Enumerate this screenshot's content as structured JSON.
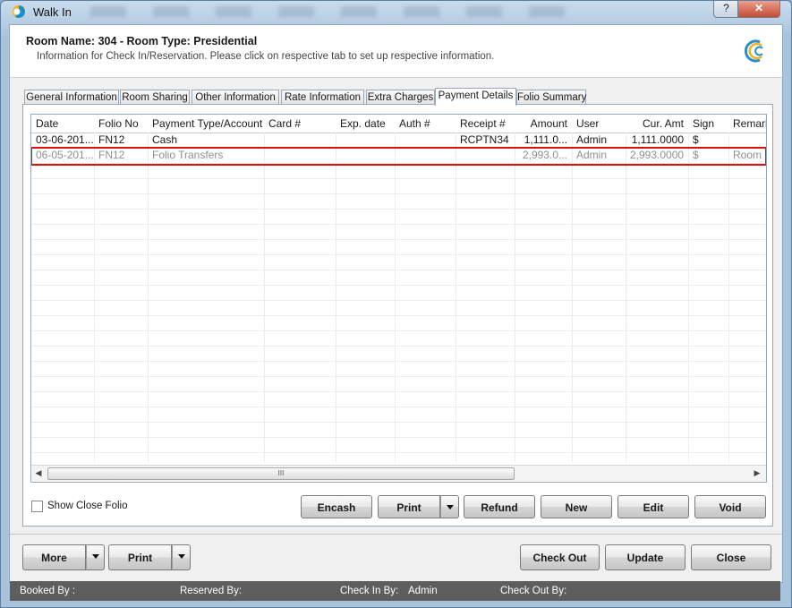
{
  "window": {
    "title": "Walk In",
    "help_label": "?",
    "close_label": "✕"
  },
  "header": {
    "room_title": "Room Name: 304 - Room Type: Presidential",
    "subtitle": "Information for Check In/Reservation. Please click on respective tab to set up respective information."
  },
  "tabs": [
    {
      "label": "General Information",
      "active": false
    },
    {
      "label": "Room Sharing",
      "active": false
    },
    {
      "label": "Other Information",
      "active": false
    },
    {
      "label": "Rate Information",
      "active": false
    },
    {
      "label": "Extra Charges",
      "active": false
    },
    {
      "label": "Payment Details",
      "active": true
    },
    {
      "label": "Folio Summary",
      "active": false
    }
  ],
  "grid": {
    "columns": [
      "Date",
      "Folio No",
      "Payment Type/Account",
      "Card #",
      "Exp. date",
      "Auth #",
      "Receipt #",
      "Amount",
      "User",
      "Cur. Amt",
      "Sign",
      "Remark"
    ],
    "rows": [
      [
        "03-06-201...",
        "FN12",
        "Cash",
        "",
        "",
        "",
        "RCPTN34",
        "1,111.0...",
        "Admin",
        "1,111.0000",
        "$",
        ""
      ],
      [
        "06-05-201...",
        "FN12",
        "Folio Transfers",
        "",
        "",
        "",
        "",
        "2,993.0...",
        "Admin",
        "2,993.0000",
        "$",
        "Room"
      ]
    ],
    "scroll_grip": "III",
    "scroll_left": "◀",
    "scroll_right": "▶"
  },
  "options": {
    "show_close_folio_label": "Show Close Folio",
    "show_close_folio_checked": false
  },
  "actions": {
    "encash": "Encash",
    "print": "Print",
    "refund": "Refund",
    "new": "New",
    "edit": "Edit",
    "void": "Void"
  },
  "footer_buttons": {
    "more": "More",
    "print": "Print",
    "check_out": "Check Out",
    "update": "Update",
    "close": "Close"
  },
  "status": {
    "booked_by_label": "Booked By :",
    "booked_by_value": "",
    "reserved_by_label": "Reserved By:",
    "reserved_by_value": "",
    "check_in_by_label": "Check In By:",
    "check_in_by_value": "Admin",
    "check_out_by_label": "Check Out By:",
    "check_out_by_value": ""
  },
  "colors": {
    "highlight_border": "#e01010",
    "status_bar": "#5e5e5e",
    "dimmed_row_text": "#8f8f8f"
  }
}
